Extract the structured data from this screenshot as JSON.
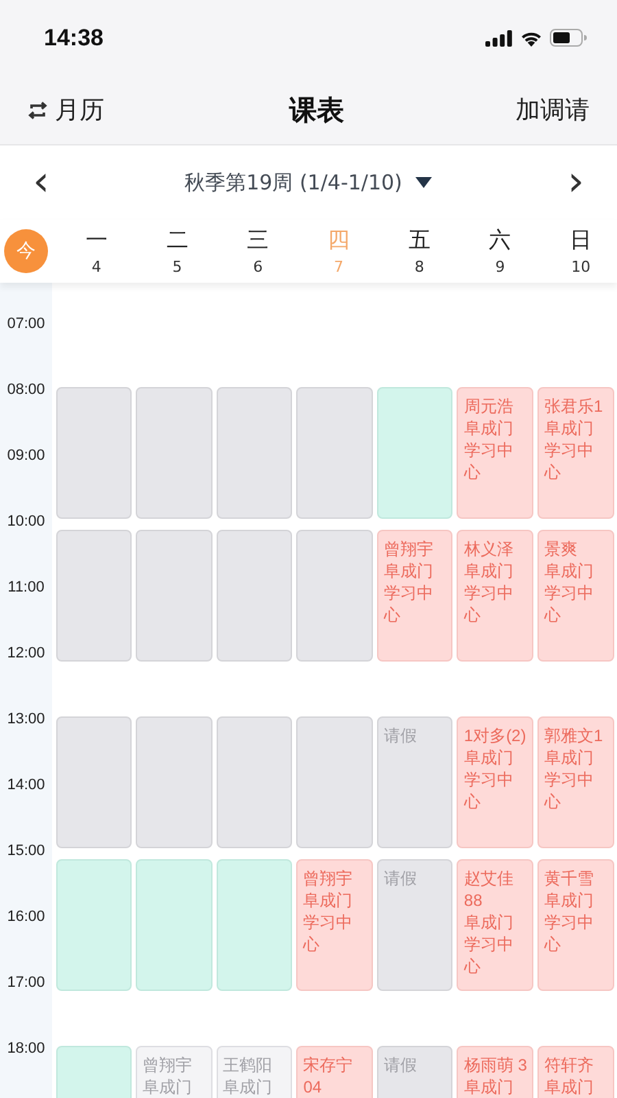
{
  "status_bar": {
    "time": "14:38"
  },
  "nav": {
    "left_label": "月历",
    "title": "课表",
    "right_label": "加调请"
  },
  "week": {
    "prev": "‹",
    "title": "秋季第19周 (1/4-1/10)",
    "next": "›"
  },
  "today_button": "今",
  "days": [
    {
      "name": "一",
      "date": "4",
      "selected": false
    },
    {
      "name": "二",
      "date": "5",
      "selected": false
    },
    {
      "name": "三",
      "date": "6",
      "selected": false
    },
    {
      "name": "四",
      "date": "7",
      "selected": true
    },
    {
      "name": "五",
      "date": "8",
      "selected": false
    },
    {
      "name": "六",
      "date": "9",
      "selected": false
    },
    {
      "name": "日",
      "date": "10",
      "selected": false
    }
  ],
  "times": [
    "07:00",
    "08:00",
    "09:00",
    "10:00",
    "11:00",
    "12:00",
    "13:00",
    "14:00",
    "15:00",
    "16:00",
    "17:00",
    "18:00"
  ],
  "rows": [
    {
      "cells": [
        {
          "kind": "empty"
        },
        {
          "kind": "empty"
        },
        {
          "kind": "empty"
        },
        {
          "kind": "empty"
        },
        {
          "kind": "free"
        },
        {
          "kind": "lesson",
          "name": "周元浩",
          "place": "阜成门学习中心"
        },
        {
          "kind": "lesson",
          "name": "张君乐1",
          "place": "阜成门学习中心"
        }
      ]
    },
    {
      "cells": [
        {
          "kind": "empty"
        },
        {
          "kind": "empty"
        },
        {
          "kind": "empty"
        },
        {
          "kind": "empty"
        },
        {
          "kind": "lesson",
          "name": "曾翔宇",
          "place": "阜成门学习中心"
        },
        {
          "kind": "lesson",
          "name": "林义泽",
          "place": "阜成门学习中心"
        },
        {
          "kind": "lesson",
          "name": "景爽",
          "place": "阜成门学习中心"
        }
      ]
    },
    {
      "cells": [
        {
          "kind": "empty"
        },
        {
          "kind": "empty"
        },
        {
          "kind": "empty"
        },
        {
          "kind": "empty"
        },
        {
          "kind": "leave",
          "name": "请假"
        },
        {
          "kind": "lesson",
          "name": "1对多(2)",
          "place": "阜成门学习中心"
        },
        {
          "kind": "lesson",
          "name": "郭雅文1",
          "place": "阜成门学习中心"
        }
      ]
    },
    {
      "cells": [
        {
          "kind": "free"
        },
        {
          "kind": "free"
        },
        {
          "kind": "free"
        },
        {
          "kind": "lesson",
          "name": "曾翔宇",
          "place": "阜成门学习中心"
        },
        {
          "kind": "leave",
          "name": "请假"
        },
        {
          "kind": "lesson",
          "name": "赵艾佳88",
          "place": "阜成门学习中心"
        },
        {
          "kind": "lesson",
          "name": "黄千雪",
          "place": "阜成门学习中心"
        }
      ]
    },
    {
      "cells": [
        {
          "kind": "free"
        },
        {
          "kind": "past",
          "name": "曾翔宇",
          "place": "阜成门"
        },
        {
          "kind": "past",
          "name": "王鹤阳",
          "place": "阜成门"
        },
        {
          "kind": "lesson",
          "name": "宋存宁04"
        },
        {
          "kind": "leave",
          "name": "请假"
        },
        {
          "kind": "lesson",
          "name": "杨雨萌 3",
          "place": "阜成门"
        },
        {
          "kind": "lesson",
          "name": "符轩齐",
          "place": "阜成门"
        }
      ]
    }
  ]
}
